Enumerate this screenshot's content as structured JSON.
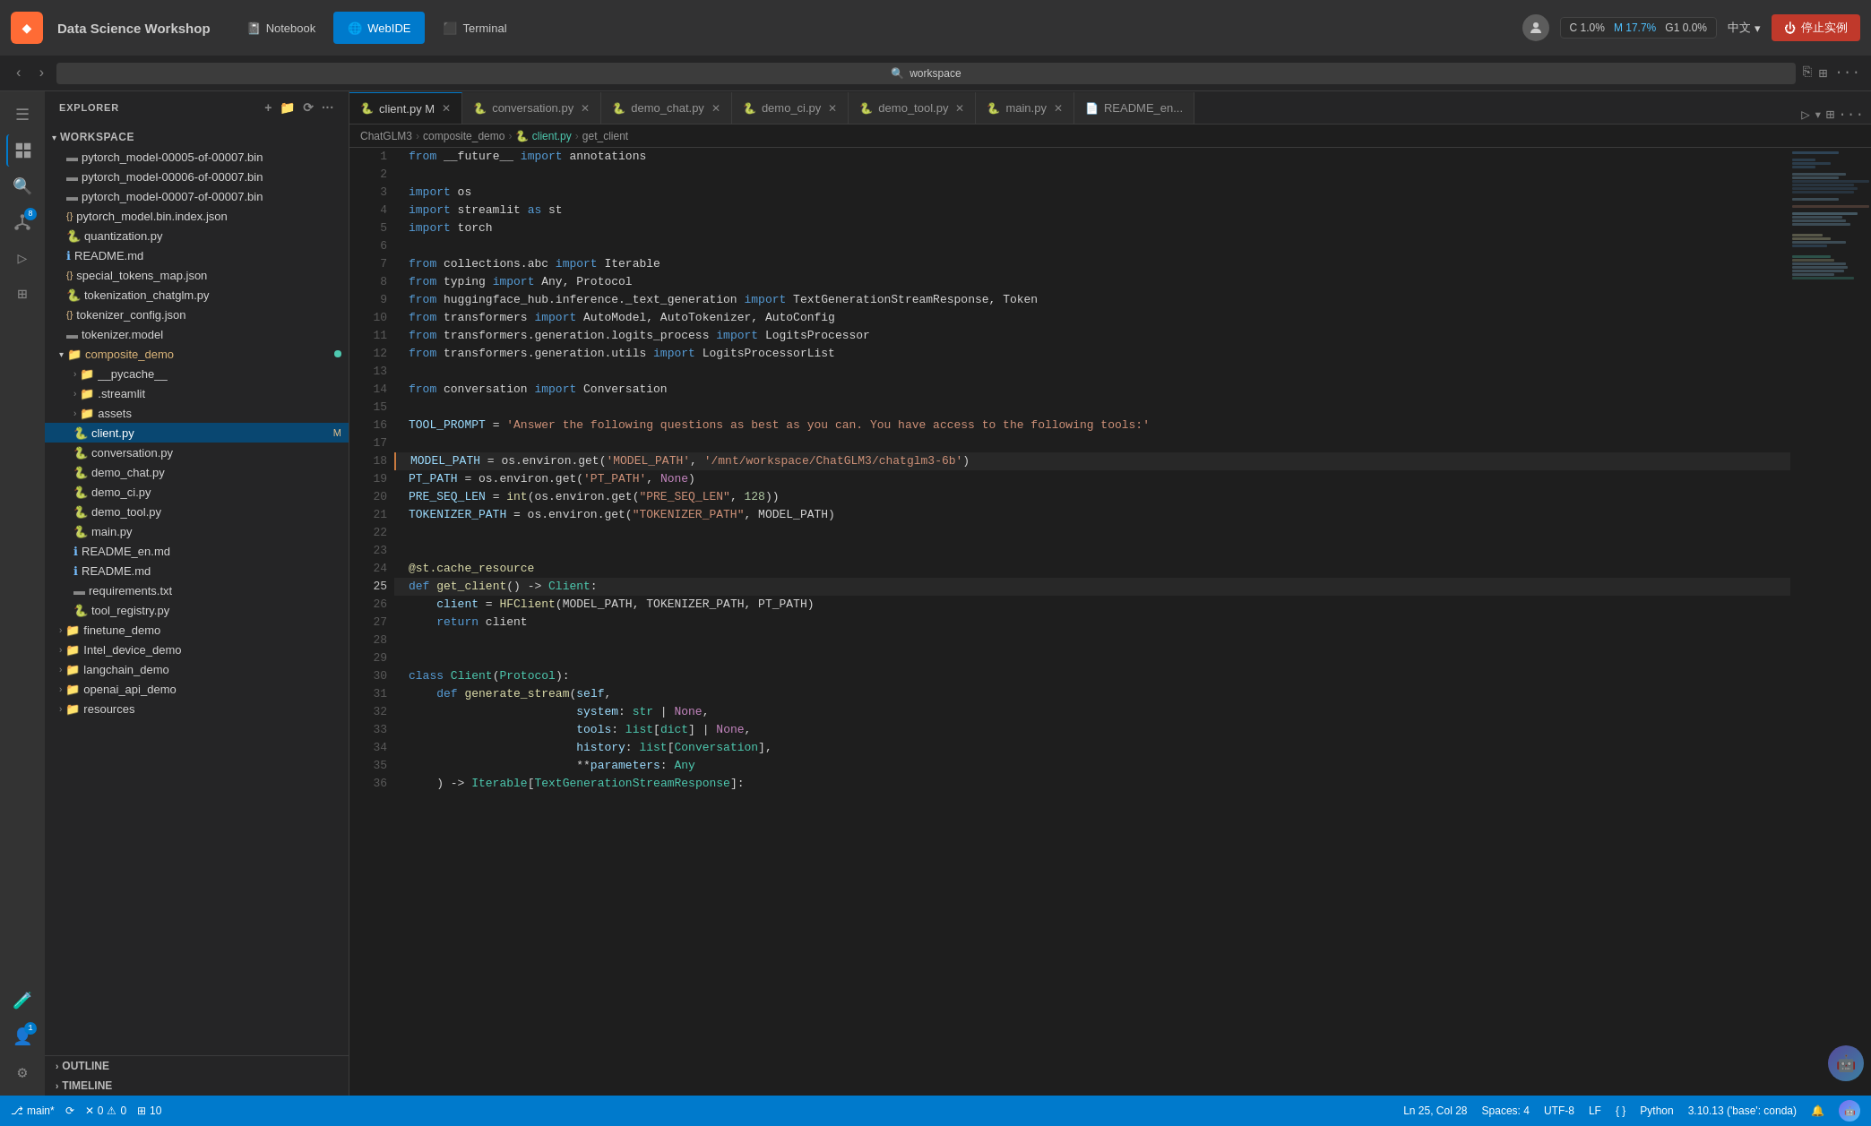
{
  "titleBar": {
    "appTitle": "Data Science Workshop",
    "tabs": [
      {
        "id": "notebook",
        "label": "Notebook",
        "icon": "📓",
        "active": false
      },
      {
        "id": "webide",
        "label": "WebIDE",
        "icon": "🌐",
        "active": true
      },
      {
        "id": "terminal",
        "label": "Terminal",
        "icon": "⬛",
        "active": false
      }
    ],
    "resources": {
      "cpu": "C 1.0%",
      "memory": "M 17.7%",
      "gpu": "G1 0.0%"
    },
    "language": "中文",
    "stopButton": "停止实例"
  },
  "navBar": {
    "addressBar": "workspace",
    "backArrow": "‹",
    "forwardArrow": "›"
  },
  "sidebar": {
    "header": "EXPLORER",
    "workspace": "WORKSPACE",
    "files": [
      {
        "name": "pytorch_model-00005-of-00007.bin",
        "icon": "📄",
        "indent": 16
      },
      {
        "name": "pytorch_model-00006-of-00007.bin",
        "icon": "📄",
        "indent": 16
      },
      {
        "name": "pytorch_model-00007-of-00007.bin",
        "icon": "📄",
        "indent": 16
      },
      {
        "name": "pytorch_model.bin.index.json",
        "icon": "{}",
        "indent": 16,
        "color": "#e2c08d"
      },
      {
        "name": "quantization.py",
        "icon": "🐍",
        "indent": 16
      },
      {
        "name": "README.md",
        "icon": "ℹ️",
        "indent": 16
      },
      {
        "name": "special_tokens_map.json",
        "icon": "{}",
        "indent": 16,
        "color": "#e2c08d"
      },
      {
        "name": "tokenization_chatglm.py",
        "icon": "🐍",
        "indent": 16
      },
      {
        "name": "tokenizer_config.json",
        "icon": "{}",
        "indent": 16,
        "color": "#e2c08d"
      },
      {
        "name": "tokenizer.model",
        "icon": "📄",
        "indent": 16
      },
      {
        "name": "composite_demo",
        "icon": "📁",
        "indent": 8,
        "isDir": true,
        "expanded": true,
        "hasDot": true
      },
      {
        "name": "__pycache__",
        "icon": "📁",
        "indent": 24,
        "isDir": true,
        "collapsed": true
      },
      {
        "name": ".streamlit",
        "icon": "📁",
        "indent": 24,
        "isDir": true,
        "collapsed": true
      },
      {
        "name": "assets",
        "icon": "📁",
        "indent": 24,
        "isDir": true,
        "collapsed": true
      },
      {
        "name": "client.py",
        "icon": "🐍",
        "indent": 24,
        "active": true,
        "badge": "M"
      },
      {
        "name": "conversation.py",
        "icon": "🐍",
        "indent": 24
      },
      {
        "name": "demo_chat.py",
        "icon": "🐍",
        "indent": 24
      },
      {
        "name": "demo_ci.py",
        "icon": "🐍",
        "indent": 24
      },
      {
        "name": "demo_tool.py",
        "icon": "🐍",
        "indent": 24
      },
      {
        "name": "main.py",
        "icon": "🐍",
        "indent": 24
      },
      {
        "name": "README_en.md",
        "icon": "ℹ️",
        "indent": 24
      },
      {
        "name": "README.md",
        "icon": "ℹ️",
        "indent": 24
      },
      {
        "name": "requirements.txt",
        "icon": "📄",
        "indent": 24
      },
      {
        "name": "tool_registry.py",
        "icon": "🐍",
        "indent": 24
      },
      {
        "name": "finetune_demo",
        "icon": "📁",
        "indent": 8,
        "isDir": true,
        "collapsed": true
      },
      {
        "name": "Intel_device_demo",
        "icon": "📁",
        "indent": 8,
        "isDir": true,
        "collapsed": true
      },
      {
        "name": "langchain_demo",
        "icon": "📁",
        "indent": 8,
        "isDir": true,
        "collapsed": true
      },
      {
        "name": "openai_api_demo",
        "icon": "📁",
        "indent": 8,
        "isDir": true,
        "collapsed": true
      },
      {
        "name": "resources",
        "icon": "📁",
        "indent": 8,
        "isDir": true,
        "collapsed": true
      }
    ],
    "outline": "OUTLINE",
    "timeline": "TIMELINE"
  },
  "editorTabs": [
    {
      "name": "client.py",
      "active": true,
      "modified": true,
      "color": "#4ec9b0"
    },
    {
      "name": "conversation.py",
      "active": false,
      "color": "#4ec9b0"
    },
    {
      "name": "demo_chat.py",
      "active": false,
      "color": "#4ec9b0"
    },
    {
      "name": "demo_ci.py",
      "active": false,
      "color": "#4ec9b0"
    },
    {
      "name": "demo_tool.py",
      "active": false,
      "color": "#4ec9b0"
    },
    {
      "name": "main.py",
      "active": false,
      "color": "#4ec9b0"
    },
    {
      "name": "README_en...",
      "active": false,
      "color": "#cccccc"
    }
  ],
  "breadcrumb": {
    "parts": [
      "ChatGLM3",
      "composite_demo",
      "client.py",
      "get_client"
    ]
  },
  "codeLines": [
    {
      "num": 1,
      "content": "from __future__ import annotations",
      "tokens": [
        {
          "t": "kw",
          "v": "from"
        },
        {
          "t": "op",
          "v": " __future__ "
        },
        {
          "t": "kw",
          "v": "import"
        },
        {
          "t": "op",
          "v": " annotations"
        }
      ]
    },
    {
      "num": 2,
      "content": ""
    },
    {
      "num": 3,
      "content": "import os",
      "tokens": [
        {
          "t": "kw",
          "v": "import"
        },
        {
          "t": "op",
          "v": " os"
        }
      ]
    },
    {
      "num": 4,
      "content": "import streamlit as st",
      "tokens": [
        {
          "t": "kw",
          "v": "import"
        },
        {
          "t": "op",
          "v": " streamlit "
        },
        {
          "t": "kw",
          "v": "as"
        },
        {
          "t": "op",
          "v": " st"
        }
      ]
    },
    {
      "num": 5,
      "content": "import torch",
      "tokens": [
        {
          "t": "kw",
          "v": "import"
        },
        {
          "t": "op",
          "v": " torch"
        }
      ]
    },
    {
      "num": 6,
      "content": ""
    },
    {
      "num": 7,
      "content": "from collections.abc import Iterable",
      "tokens": [
        {
          "t": "kw",
          "v": "from"
        },
        {
          "t": "op",
          "v": " collections.abc "
        },
        {
          "t": "kw",
          "v": "import"
        },
        {
          "t": "op",
          "v": " Iterable"
        }
      ]
    },
    {
      "num": 8,
      "content": "from typing import Any, Protocol",
      "tokens": [
        {
          "t": "kw",
          "v": "from"
        },
        {
          "t": "op",
          "v": " typing "
        },
        {
          "t": "kw",
          "v": "import"
        },
        {
          "t": "op",
          "v": " Any, Protocol"
        }
      ]
    },
    {
      "num": 9,
      "content": "from huggingface_hub.inference._text_generation import TextGenerationStreamResponse, Token",
      "tokens": [
        {
          "t": "kw",
          "v": "from"
        },
        {
          "t": "op",
          "v": " huggingface_hub.inference._text_generation "
        },
        {
          "t": "kw",
          "v": "import"
        },
        {
          "t": "op",
          "v": " TextGenerationStreamResponse, Token"
        }
      ]
    },
    {
      "num": 10,
      "content": "from transformers import AutoModel, AutoTokenizer, AutoConfig",
      "tokens": [
        {
          "t": "kw",
          "v": "from"
        },
        {
          "t": "op",
          "v": " transformers "
        },
        {
          "t": "kw",
          "v": "import"
        },
        {
          "t": "op",
          "v": " AutoModel, AutoTokenizer, AutoConfig"
        }
      ]
    },
    {
      "num": 11,
      "content": "from transformers.generation.logits_process import LogitsProcessor",
      "tokens": [
        {
          "t": "kw",
          "v": "from"
        },
        {
          "t": "op",
          "v": " transformers.generation.logits_process "
        },
        {
          "t": "kw",
          "v": "import"
        },
        {
          "t": "op",
          "v": " LogitsProcessor"
        }
      ]
    },
    {
      "num": 12,
      "content": "from transformers.generation.utils import LogitsProcessorList",
      "tokens": [
        {
          "t": "kw",
          "v": "from"
        },
        {
          "t": "op",
          "v": " transformers.generation.utils "
        },
        {
          "t": "kw",
          "v": "import"
        },
        {
          "t": "op",
          "v": " LogitsProcessorList"
        }
      ]
    },
    {
      "num": 13,
      "content": ""
    },
    {
      "num": 14,
      "content": "from conversation import Conversation",
      "tokens": [
        {
          "t": "kw",
          "v": "from"
        },
        {
          "t": "op",
          "v": " conversation "
        },
        {
          "t": "kw",
          "v": "import"
        },
        {
          "t": "op",
          "v": " Conversation"
        }
      ]
    },
    {
      "num": 15,
      "content": ""
    },
    {
      "num": 16,
      "content": "TOOL_PROMPT = 'Answer the following questions as best as you can. You have access to the following tools:'",
      "tokens": [
        {
          "t": "var",
          "v": "TOOL_PROMPT"
        },
        {
          "t": "op",
          "v": " = "
        },
        {
          "t": "str",
          "v": "'Answer the following questions as best as you can. You have access to the following tools:'"
        }
      ]
    },
    {
      "num": 17,
      "content": ""
    },
    {
      "num": 18,
      "content": "MODEL_PATH = os.environ.get('MODEL_PATH', '/mnt/workspace/ChatGLM3/chatglm3-6b')",
      "highlighted": true
    },
    {
      "num": 19,
      "content": "PT_PATH = os.environ.get('PT_PATH', None)"
    },
    {
      "num": 20,
      "content": "PRE_SEQ_LEN = int(os.environ.get(\"PRE_SEQ_LEN\", 128))"
    },
    {
      "num": 21,
      "content": "TOKENIZER_PATH = os.environ.get(\"TOKENIZER_PATH\", MODEL_PATH)"
    },
    {
      "num": 22,
      "content": ""
    },
    {
      "num": 23,
      "content": ""
    },
    {
      "num": 24,
      "content": "@st.cache_resource"
    },
    {
      "num": 25,
      "content": "def get_client() -> Client:"
    },
    {
      "num": 26,
      "content": "    client = HFClient(MODEL_PATH, TOKENIZER_PATH, PT_PATH)"
    },
    {
      "num": 27,
      "content": "    return client"
    },
    {
      "num": 28,
      "content": ""
    },
    {
      "num": 29,
      "content": ""
    },
    {
      "num": 30,
      "content": "class Client(Protocol):"
    },
    {
      "num": 31,
      "content": "    def generate_stream(self,"
    },
    {
      "num": 32,
      "content": "                        system: str | None,"
    },
    {
      "num": 33,
      "content": "                        tools: list[dict] | None,"
    },
    {
      "num": 34,
      "content": "                        history: list[Conversation],"
    },
    {
      "num": 35,
      "content": "                        **parameters: Any"
    },
    {
      "num": 36,
      "content": "    ) -> Iterable[TextGenerationStreamResponse]:"
    }
  ],
  "statusBar": {
    "branch": "main*",
    "sync": "⟳",
    "errors": "0",
    "warnings": "0",
    "cursor": "Ln 25, Col 28",
    "spaces": "Spaces: 4",
    "encoding": "UTF-8",
    "eol": "LF",
    "language": "Python",
    "pythonVersion": "3.10.13 ('base': conda)"
  }
}
